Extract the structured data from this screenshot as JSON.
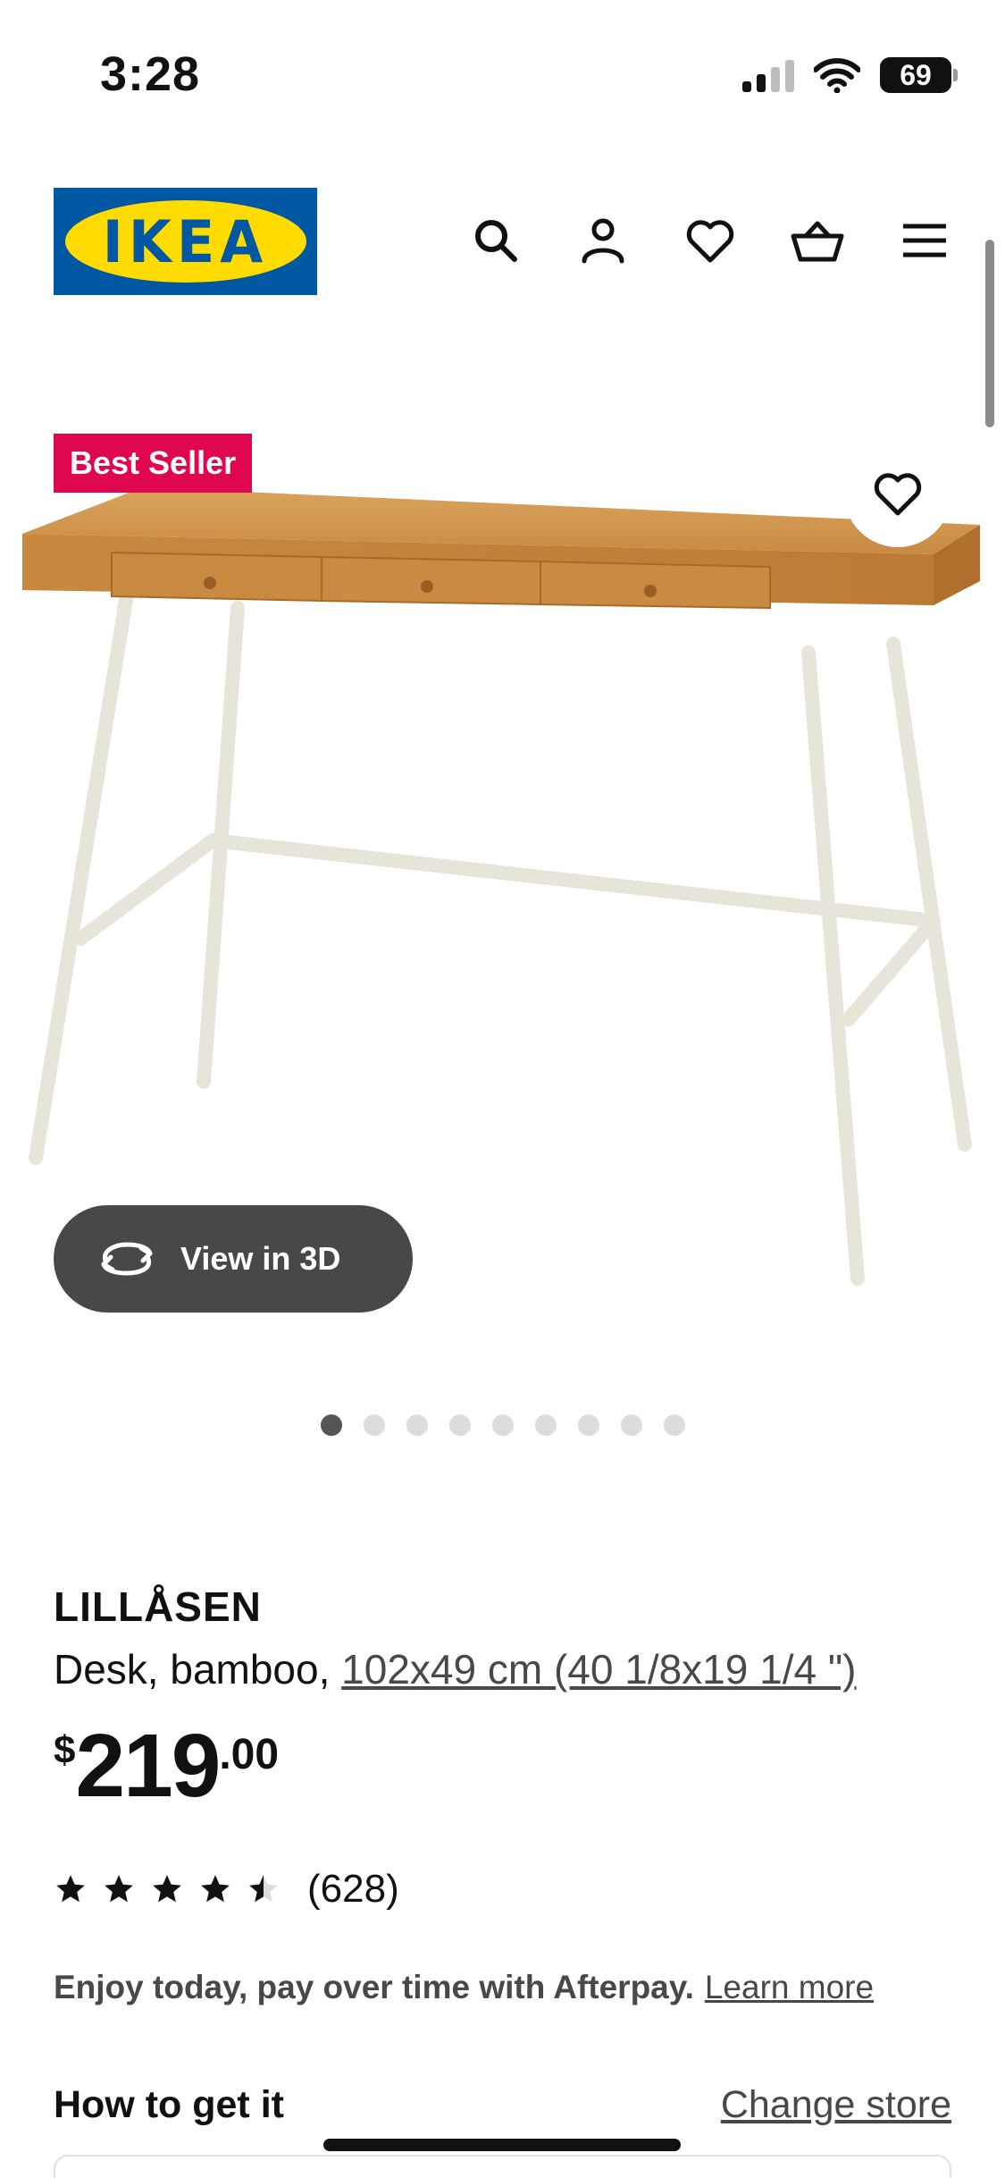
{
  "status_bar": {
    "time": "3:28",
    "battery": "69"
  },
  "header": {
    "logo_text": "IKEA",
    "icons": [
      "search-icon",
      "account-icon",
      "heart-icon",
      "basket-icon",
      "menu-icon"
    ]
  },
  "hero": {
    "badge": "Best Seller",
    "view_3d_label": "View in 3D",
    "image_count": 9,
    "active_image_index": 0
  },
  "product": {
    "name": "LILLÅSEN",
    "description_prefix": "Desk, bamboo,",
    "dimensions_link": "102x49 cm (40 1/8x19 1/4 \")",
    "price_currency": "$",
    "price_integer": "219",
    "price_decimal": ".00",
    "rating_value": 4.5,
    "rating_count": "(628)"
  },
  "afterpay": {
    "text": "Enjoy today, pay over time with Afterpay.",
    "link": "Learn more"
  },
  "delivery": {
    "heading": "How to get it",
    "change_store": "Change store"
  },
  "colors": {
    "ikea_blue": "#0058a3",
    "ikea_yellow": "#ffdb00",
    "badge_red": "#e00751",
    "view3d_bg": "#484848"
  }
}
